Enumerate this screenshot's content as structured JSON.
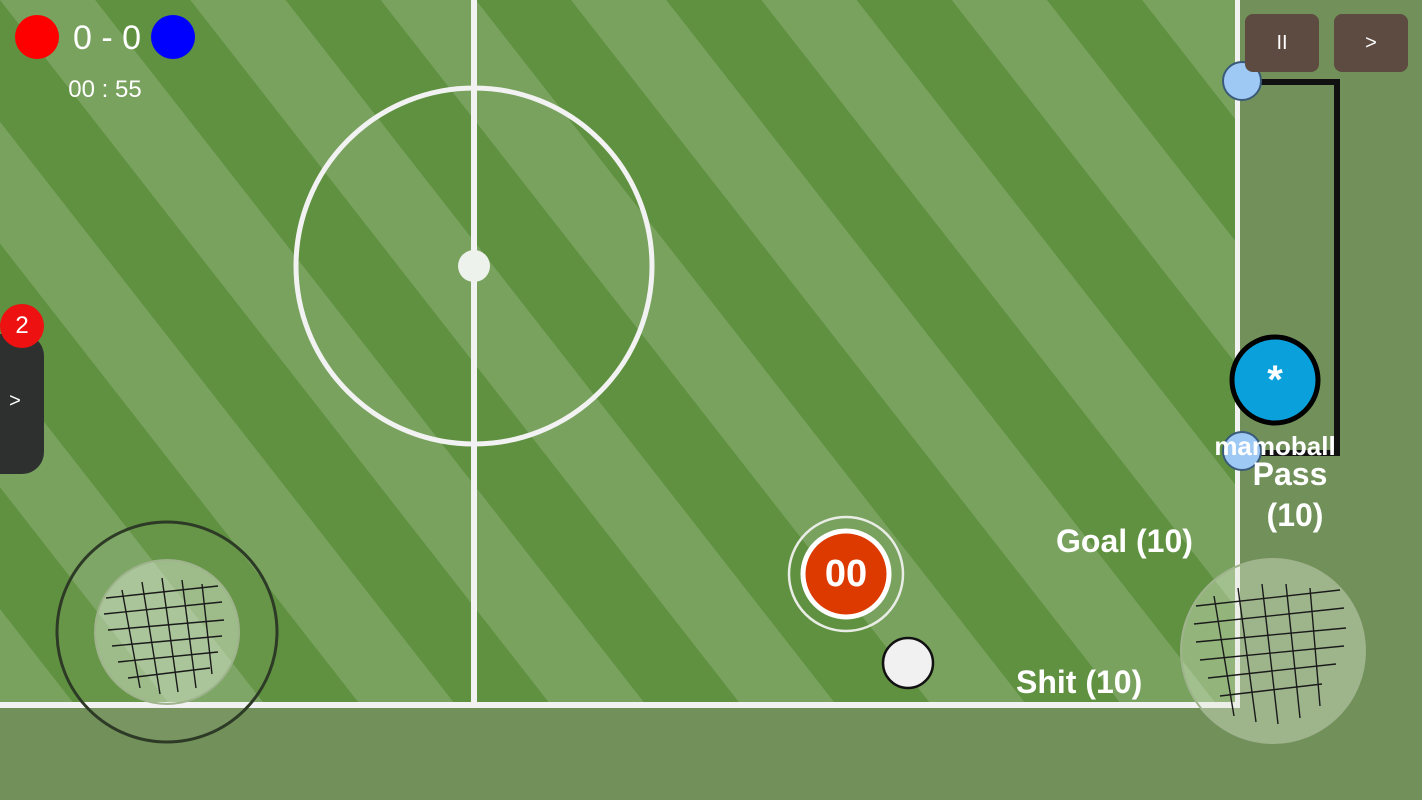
{
  "scoreboard": {
    "home_color": "#ff0000",
    "away_color": "#0000ff",
    "score": "0 - 0",
    "timer": "00 : 55"
  },
  "controls": {
    "pause_label": "II",
    "next_label": ">"
  },
  "side_panel": {
    "badge_count": "2",
    "expand_label": ">"
  },
  "players": {
    "controlled_number": "00",
    "controlled_color": "#dd3a00",
    "goalkeeper_label": "*",
    "goalkeeper_color": "#0aa0dc",
    "goalkeeper_name": "mamoball",
    "teammate_color": "#9fc9f5"
  },
  "actions": {
    "pass": "Pass",
    "pass_power": "(10)",
    "goal": "Goal (10)",
    "shoot": "Shit (10)"
  },
  "colors": {
    "pitch_green": "#5f9140",
    "stripe_green": "#78a25e",
    "outer_grass": "#72915a",
    "line_white": "#f2f2f2"
  }
}
